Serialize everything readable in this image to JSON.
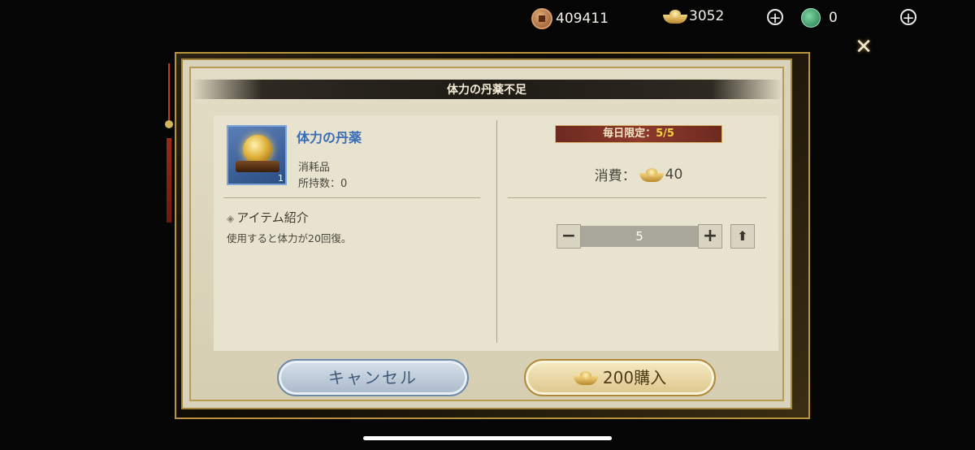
{
  "top_bar": {
    "copper_coins": "409411",
    "gold_ingots": "3052",
    "jade": "0",
    "plus_symbol": "+",
    "icons": [
      "copper-coin-icon",
      "gold-ingot-icon",
      "jade-icon",
      "plus-icon",
      "close-icon"
    ]
  },
  "close_symbol": "✕",
  "dialog": {
    "title": "体力の丹薬不足",
    "item": {
      "name": "体力の丹薬",
      "count_badge": "1",
      "type": "消耗品",
      "owned": "所持数：0"
    },
    "section_title": "アイテム紹介",
    "description": "使用すると体力が20回復。",
    "daily_limit_label": "毎日限定：",
    "daily_limit_value": "5/5",
    "cost_label": "消費：",
    "cost_value": "40",
    "stepper": {
      "minus": "−",
      "value": "5",
      "plus": "+",
      "max": "⬆"
    },
    "cancel_label": "キャンセル",
    "buy_label": "200購入"
  }
}
